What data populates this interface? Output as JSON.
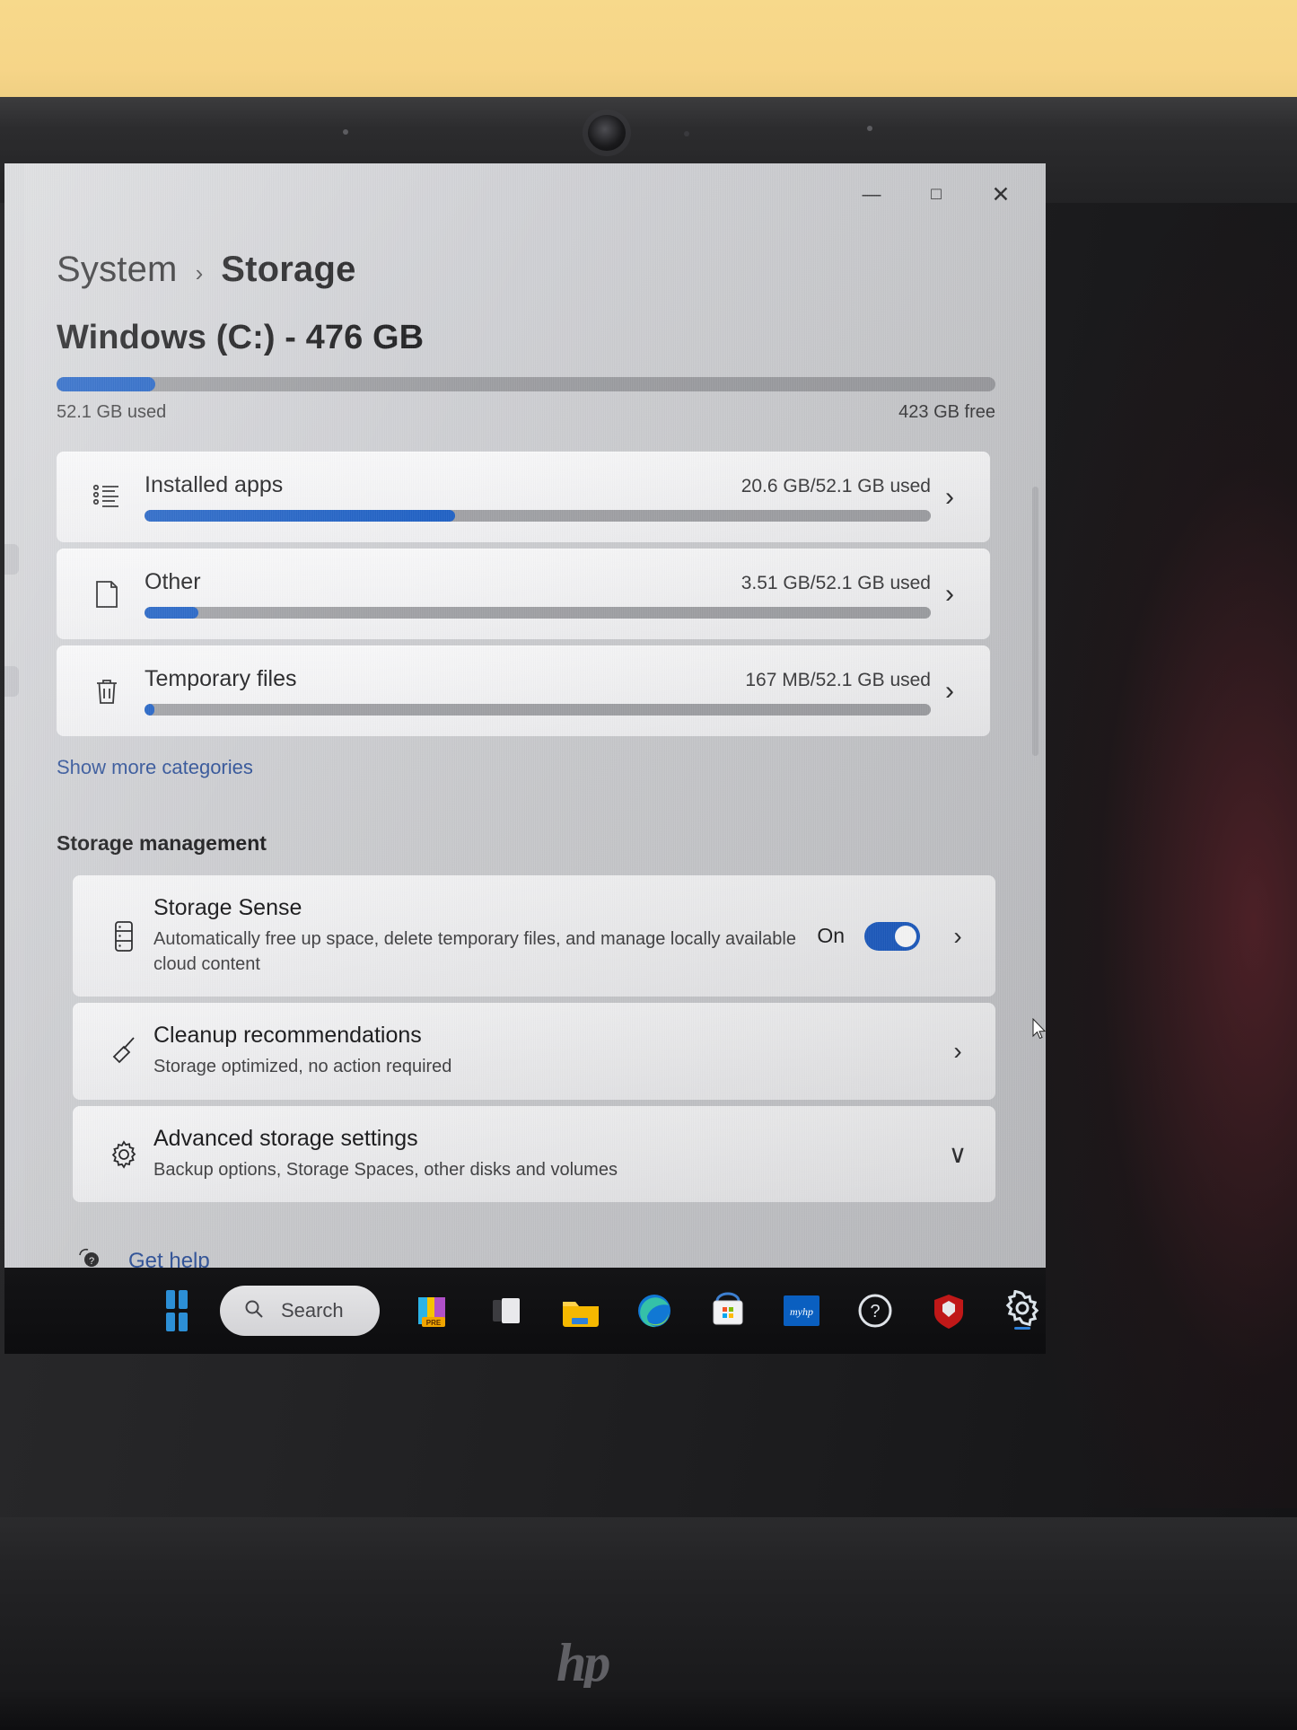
{
  "window": {
    "controls": [
      {
        "name": "minimize",
        "glyph": "—"
      },
      {
        "name": "maximize",
        "glyph": "□"
      },
      {
        "name": "close",
        "glyph": "✕"
      }
    ]
  },
  "breadcrumb": {
    "parent": "System",
    "separator": "›",
    "current": "Storage"
  },
  "drive": {
    "title": "Windows (C:) - 476 GB",
    "used_label": "52.1 GB used",
    "free_label": "423 GB free",
    "used_percent": 10.5
  },
  "categories": [
    {
      "icon": "installed-apps-icon",
      "name": "Installed apps",
      "value": "20.6 GB/52.1 GB used",
      "fill_percent": 39.5,
      "chevron": "›"
    },
    {
      "icon": "other-files-icon",
      "name": "Other",
      "value": "3.51 GB/52.1 GB used",
      "fill_percent": 6.8,
      "chevron": "›"
    },
    {
      "icon": "trash-icon",
      "name": "Temporary files",
      "value": "167 MB/52.1 GB used",
      "fill_percent": 0.8,
      "chevron": "›"
    }
  ],
  "show_more_label": "Show more categories",
  "management": {
    "section_title": "Storage management",
    "items": [
      {
        "icon": "storage-sense-icon",
        "title": "Storage Sense",
        "desc": "Automatically free up space, delete temporary files, and manage locally available cloud content",
        "toggle_label": "On",
        "toggle_on": true,
        "chevron": "›"
      },
      {
        "icon": "broom-icon",
        "title": "Cleanup recommendations",
        "desc": "Storage optimized, no action required",
        "chevron": "›"
      },
      {
        "icon": "gear-icon",
        "title": "Advanced storage settings",
        "desc": "Backup options, Storage Spaces, other disks and volumes",
        "chevron": "∨"
      }
    ]
  },
  "get_help": {
    "icon": "help-icon",
    "label": "Get help"
  },
  "taskbar": {
    "start_icon": "windows-start-icon",
    "search_placeholder": "Search",
    "apps": [
      {
        "name": "adobe-premiere-icon",
        "label": "PRE"
      },
      {
        "name": "task-view-icon",
        "label": ""
      },
      {
        "name": "file-explorer-icon",
        "label": ""
      },
      {
        "name": "edge-browser-icon",
        "label": ""
      },
      {
        "name": "microsoft-store-icon",
        "label": ""
      },
      {
        "name": "myhp-icon",
        "label": "myhp"
      },
      {
        "name": "help-support-icon",
        "label": "?"
      },
      {
        "name": "mcafee-icon",
        "label": ""
      },
      {
        "name": "settings-icon",
        "label": ""
      }
    ]
  },
  "colors": {
    "accent_blue": "#1d5fc4",
    "link_blue": "#2c4f96",
    "track_gray": "#9b9ca0"
  }
}
